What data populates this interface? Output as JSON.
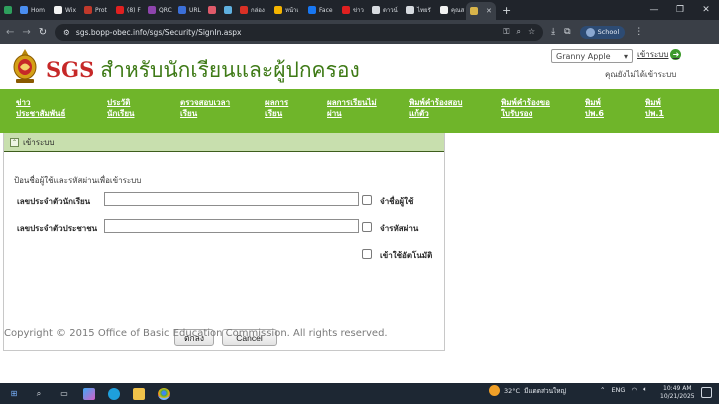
{
  "browser": {
    "tabs": [
      {
        "label": "",
        "color": "#2e9f5d"
      },
      {
        "label": "Hom",
        "color": "#4a8ef0"
      },
      {
        "label": "Wix",
        "color": "#f2f2f2"
      },
      {
        "label": "Prot",
        "color": "#c0392b"
      },
      {
        "label": "(8) F",
        "color": "#e02020"
      },
      {
        "label": "QRC",
        "color": "#8e44ad"
      },
      {
        "label": "URL",
        "color": "#3b6fd8"
      },
      {
        "label": "",
        "color": "#e05a6a"
      },
      {
        "label": "",
        "color": "#5fb0e0"
      },
      {
        "label": "กล่อง",
        "color": "#d93025"
      },
      {
        "label": "หน้าเ",
        "color": "#f4b400"
      },
      {
        "label": "Face",
        "color": "#1877f2"
      },
      {
        "label": "ข่าว",
        "color": "#e02020"
      },
      {
        "label": "ดาวน์",
        "color": "#d7dbe0"
      },
      {
        "label": "ไทยรั",
        "color": "#d7dbe0"
      },
      {
        "label": "คุณส",
        "color": "#f2f2f2"
      },
      {
        "label": "",
        "color": "#d9b44a",
        "active": true
      }
    ],
    "new_tab": "+",
    "url": "sgs.bopp-obec.info/sgs/Security/SignIn.aspx",
    "profile_label": "School"
  },
  "header": {
    "brand": "SGS",
    "title": "สำหรับนักเรียนและผู้ปกครอง",
    "theme_selected": "Granny Apple",
    "login_link": "เข้าระบบ",
    "not_logged_in": "คุณยังไม่ได้เข้าระบบ"
  },
  "menu": [
    "ข่าว\nประชาสัมพันธ์",
    "ประวัติ\nนักเรียน",
    "ตรวจสอบเวลา\nเรียน",
    "ผลการ\nเรียน",
    "ผลการเรียนไม่\nผ่าน",
    "พิมพ์คำร้องสอบ\nแก้ตัว",
    "พิมพ์คำร้องขอ\nใบรับรอง",
    "พิมพ์\nปพ.6",
    "พิมพ์\nปพ.1"
  ],
  "login": {
    "panel_title": "เข้าระบบ",
    "instruction": "ป้อนชื่อผู้ใช้และรหัสผ่านเพื่อเข้าระบบ",
    "student_id_label": "เลขประจำตัวนักเรียน",
    "student_id_value": "",
    "national_id_label": "เลขประจำตัวประชาชน",
    "national_id_value": "",
    "remember_user": "จำชื่อผู้ใช้",
    "remember_password": "จำรหัสผ่าน",
    "auto_login": "เข้าใช้อัตโนมัติ",
    "ok_button": "ตกลง",
    "cancel_button": "Cancel"
  },
  "footer": {
    "copyright": "Copyright © 2015 Office of Basic Education Commission. All rights reserved."
  },
  "taskbar": {
    "temperature": "32°C",
    "weather_text": "มีแดดส่วนใหญ่",
    "lang": "ENG",
    "lang_sub": "TH",
    "time": "10:49 AM",
    "date": "10/21/2025"
  }
}
